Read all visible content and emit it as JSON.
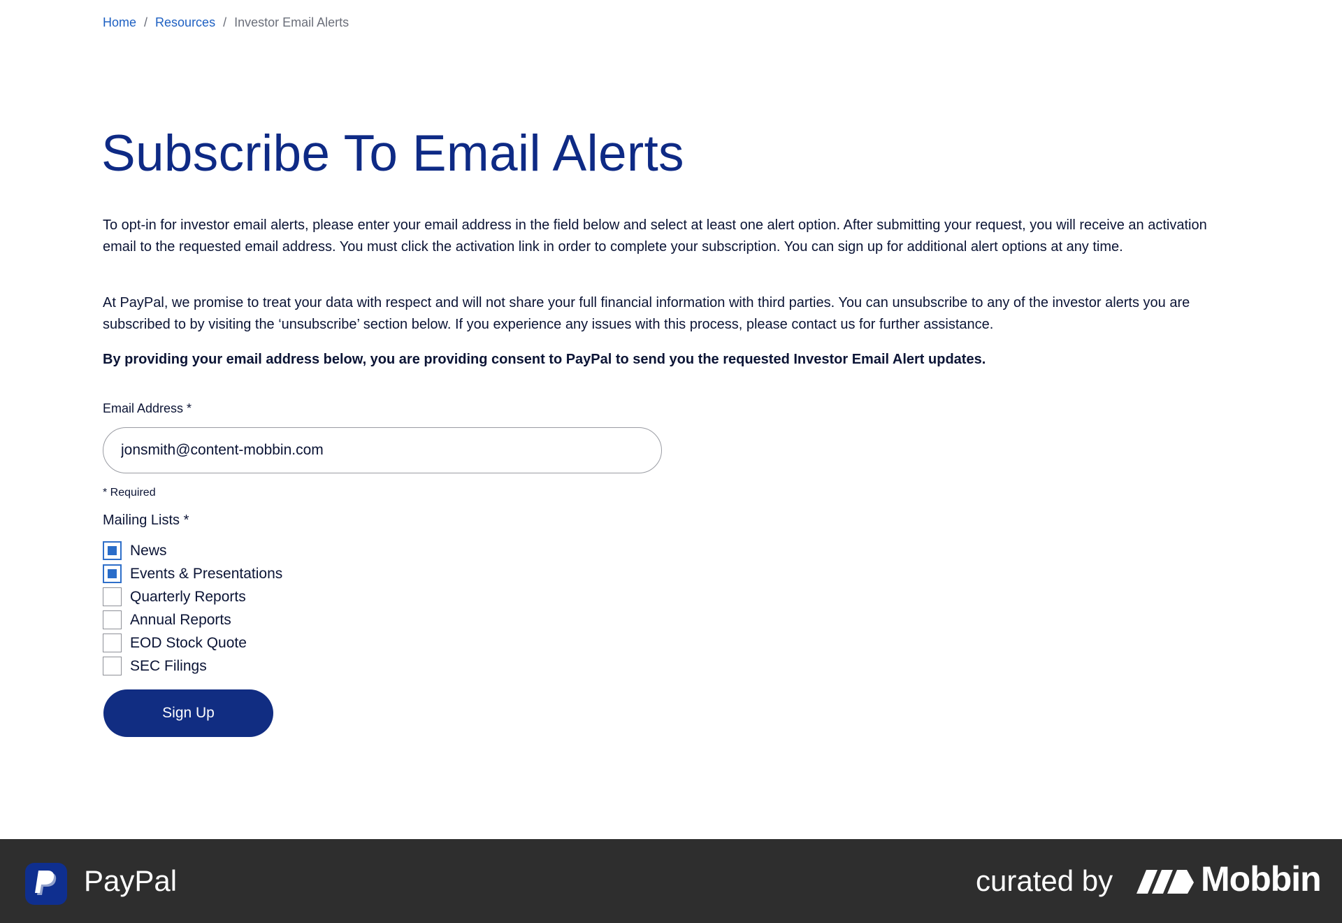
{
  "breadcrumb": {
    "home": "Home",
    "separator": "/",
    "resources": "Resources",
    "current": "Investor Email Alerts"
  },
  "page": {
    "title": "Subscribe To Email Alerts",
    "intro": "To opt-in for investor email alerts, please enter your email address in the field below and select at least one alert option. After submitting your request, you will receive an activation email to the requested email address. You must click the activation link in order to complete your subscription. You can sign up for additional alert options at any time.",
    "privacy": "At PayPal, we promise to treat your data with respect and will not share your full financial information with third parties. You can unsubscribe to any of the investor alerts you are subscribed to by visiting the ‘unsubscribe’ section below. If you experience any issues with this process, please contact us for further assistance.",
    "consent": "By providing your email address below, you are providing consent to PayPal to send you the requested Investor Email Alert updates."
  },
  "form": {
    "email_label": "Email Address *",
    "email_value": "jonsmith@content-mobbin.com",
    "required_note": "* Required",
    "lists_label": "Mailing Lists *",
    "lists": [
      {
        "label": "News",
        "checked": true
      },
      {
        "label": "Events & Presentations",
        "checked": true
      },
      {
        "label": "Quarterly Reports",
        "checked": false
      },
      {
        "label": "Annual Reports",
        "checked": false
      },
      {
        "label": "EOD Stock Quote",
        "checked": false
      },
      {
        "label": "SEC Filings",
        "checked": false
      }
    ],
    "submit_label": "Sign Up"
  },
  "footer": {
    "app_name": "PayPal",
    "curated_by": "curated by",
    "brand": "Mobbin",
    "app_icon": "paypal-logo-icon",
    "brand_icon": "mobbin-logo-icon"
  },
  "colors": {
    "title": "#0e2a85",
    "link": "#1e60c2",
    "button": "#112d82",
    "checkbox_checked": "#2a6dc9",
    "footer_bg": "#2e2e2e"
  }
}
